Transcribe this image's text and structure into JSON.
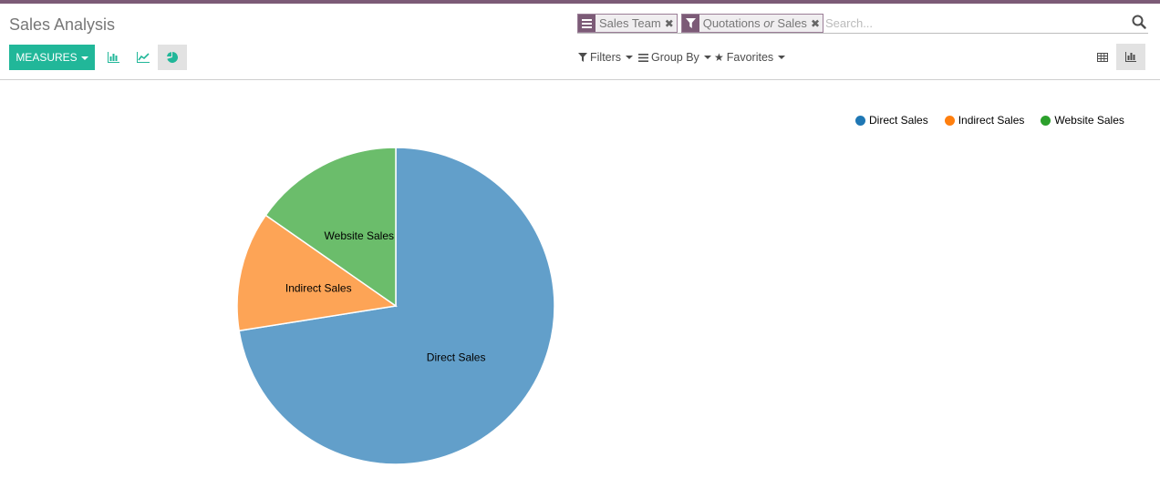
{
  "page": {
    "title": "Sales Analysis"
  },
  "search": {
    "facets": [
      {
        "icon": "list-icon",
        "text": "Sales Team"
      },
      {
        "icon": "filter-icon",
        "text_parts": [
          "Quotations",
          "or",
          "Sales"
        ]
      }
    ],
    "placeholder": "Search..."
  },
  "toolbar": {
    "measures_label": "MEASURES",
    "modes": [
      "bar-chart-icon",
      "line-chart-icon",
      "pie-chart-icon"
    ],
    "active_mode": "pie"
  },
  "filters": {
    "filters_label": "Filters",
    "group_by_label": "Group By",
    "favorites_label": "Favorites"
  },
  "views": {
    "items": [
      "pivot-table-icon",
      "graph-icon"
    ],
    "active": "graph"
  },
  "colors": {
    "topbar": "#7c5b77",
    "measures": "#21b799",
    "series": [
      "#629fca",
      "#fda456",
      "#6bbd6b"
    ],
    "legend_dots": [
      "#1f77b4",
      "#ff7f0e",
      "#2ca02c"
    ]
  },
  "chart_data": {
    "type": "pie",
    "categories": [
      "Direct Sales",
      "Indirect Sales",
      "Website Sales"
    ],
    "values": [
      72.5,
      12.2,
      15.3
    ],
    "legend_position": "top-right"
  }
}
